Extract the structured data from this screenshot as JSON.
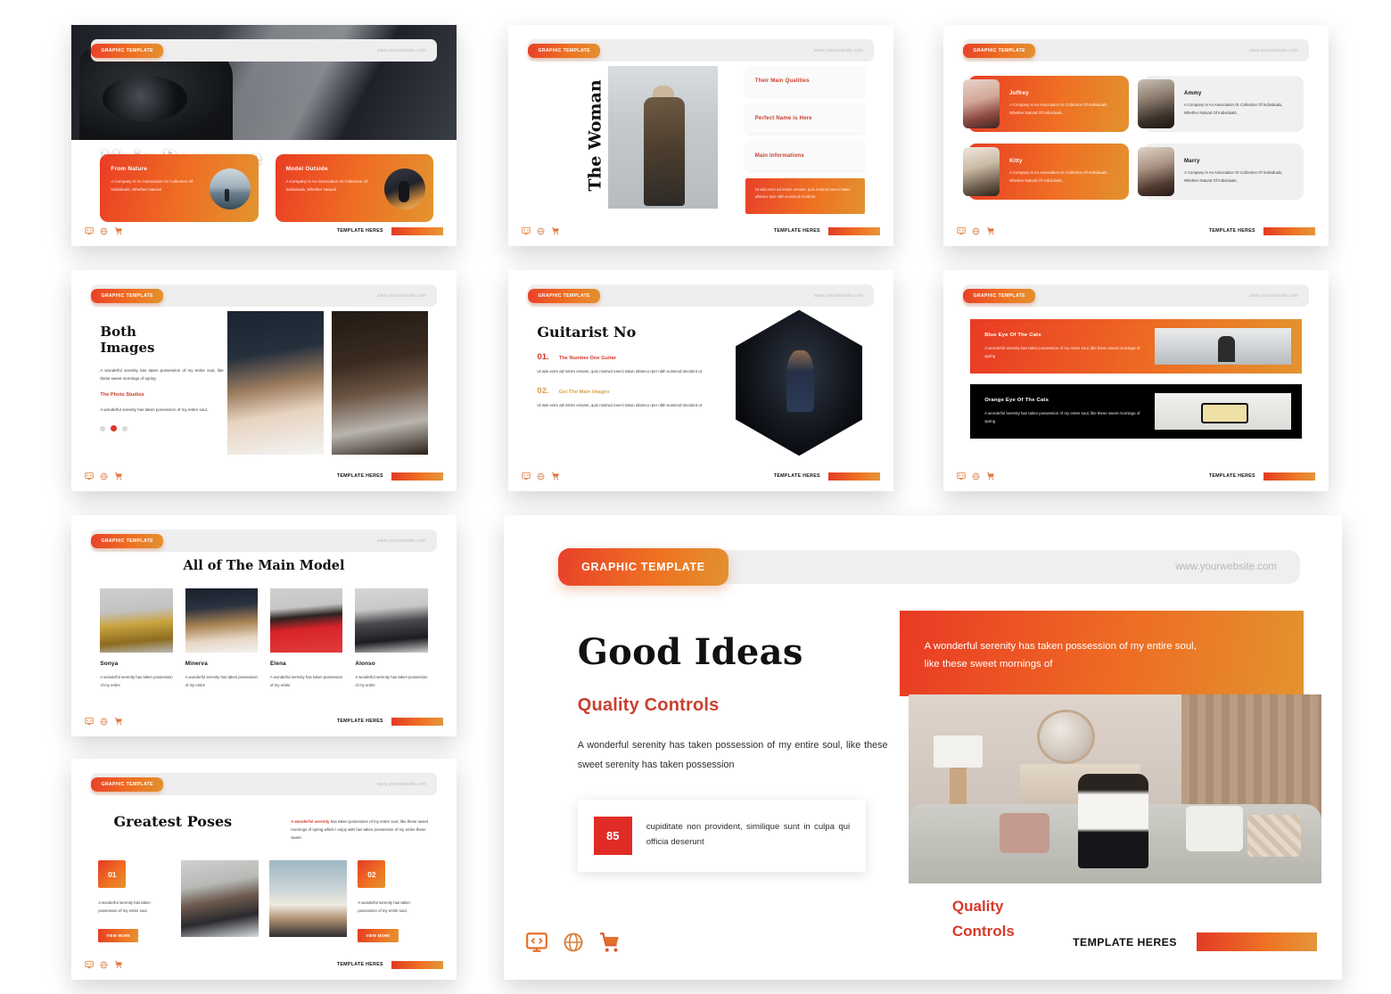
{
  "common": {
    "pill_label": "GRAPHIC TEMPLATE",
    "url": "www.yourwebsite.com",
    "footer_title": "TEMPLATE HERES",
    "icons": [
      "code-monitor-icon",
      "globe-icon",
      "shopping-cart-icon"
    ],
    "accent_red": "#e8402a",
    "accent_orange": "#e2922f",
    "accent_crimson": "#c8402f"
  },
  "slide_main_resource": {
    "title": "Main Resource",
    "subtitle": "A wonderful serenity has taken possession of my entire soul, like these sweet morning has serenity has serenity",
    "cards": [
      {
        "title": "From Nature",
        "text": "A Company Is An Association Or Collection Of Individuals, Whether Natural"
      },
      {
        "title": "Model Outside",
        "text": "A Company Is An Association Or Collection Of Individuals, Whether Natural"
      }
    ]
  },
  "slide_the_woman": {
    "title": "The Woman",
    "chips": [
      "Their Main Qualities",
      "Perfect Name is Here",
      "Main Informations"
    ],
    "note": "Ut wisi enim ad minim veniam, quis nostrud exerci tation ullamco rper nibh euismod tincidunt"
  },
  "slide_team": {
    "members": [
      {
        "name": "Joffrey",
        "text": "A Company Is An Association Or Collection Of Individuals, Whether Natural Of Individuals,"
      },
      {
        "name": "Ammy",
        "text": "A Company Is An Association Or Collection Of Individuals, Whether Natural Of Individuals,"
      },
      {
        "name": "Kitty",
        "text": "A Company Is An Association Or Collection Of Individuals, Whether Natural Of Individuals,"
      },
      {
        "name": "Marry",
        "text": "A Company Is An Association Or Collection Of Individuals, Whether Natural Of Individuals,"
      }
    ]
  },
  "slide_both_images": {
    "title_line1": "Both",
    "title_line2": "Images",
    "paragraph1": "A wonderful serenity has taken possession of my entire soul, like these sweet mornings of spring",
    "accent": "The Photo Studios",
    "paragraph2": "A wonderful serenity has taken possession of my entire soul,"
  },
  "slide_guitarist": {
    "title": "Guitarist No",
    "items": [
      {
        "num": "01.",
        "label": "The Number One Guitar",
        "text": "Ut wisi enim ad minim veniam, quis nostrud exerci tation ullamco rper nibh euismod tincidunt ut"
      },
      {
        "num": "02.",
        "label": "Get The Main Images",
        "text": "Ut wisi enim ad minim veniam, quis nostrud exerci tation ullamco rper nibh euismod tincidunt ut"
      }
    ]
  },
  "slide_cats": {
    "strips": [
      {
        "title": "Blue Eye Of The Cats",
        "text": "A wonderful serenity has taken possession of my entire soul, like these sweet mornings of spring"
      },
      {
        "title": "Orange Eye Of The Cats",
        "text": "A wonderful serenity has taken possession of my entire soul, like these sweet mornings of spring"
      }
    ]
  },
  "slide_models": {
    "title": "All of The Main Model",
    "models": [
      {
        "name": "Sonya",
        "text": "A wonderful serenity has taken possession of my entire"
      },
      {
        "name": "Minerva",
        "text": "A wonderful serenity has taken possession of my entire"
      },
      {
        "name": "Elena",
        "text": "A wonderful serenity has taken possession of my entire"
      },
      {
        "name": "Alonso",
        "text": "A wonderful serenity has taken possession of my entire"
      }
    ]
  },
  "slide_greatest_poses": {
    "title": "Greatest Poses",
    "lead_bold": "A wonderful serenity",
    "lead_rest": " has taken possession of my entire soul, like these sweet mornings of spring which I enjoy with has taken possession of my entire these sweet",
    "left": {
      "num": "01",
      "text": "A wonderful serenity has taken possession of my entire soul,",
      "button": "VIEW MORE"
    },
    "right": {
      "num": "02",
      "text": "A wonderful serenity has taken possession of my entire soul,",
      "button": "VIEW MORE"
    }
  },
  "slide_good_ideas": {
    "title": "Good Ideas",
    "subtitle": "Quality Controls",
    "lead": "A wonderful serenity has taken possession of my entire soul, like these sweet serenity has taken possession",
    "stat_number": "85",
    "stat_text": "cupiditate non provident, similique sunt in culpa qui officia deserunt",
    "side_label_line1": "Quality",
    "side_label_line2": "Controls",
    "banner": "A wonderful serenity has taken possession of my entire soul, like these sweet mornings of"
  }
}
